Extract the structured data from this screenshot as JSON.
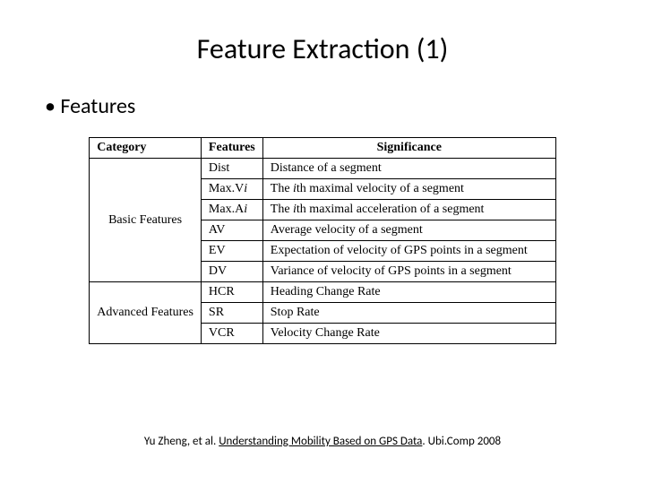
{
  "title": "Feature Extraction (1)",
  "bullet": "Features",
  "headers": {
    "category": "Category",
    "features": "Features",
    "significance": "Significance"
  },
  "categories": {
    "basic": "Basic Features",
    "advanced": "Advanced Features"
  },
  "rows": [
    {
      "feature": "Dist",
      "significance": "Distance of a segment"
    },
    {
      "feature_pre": "Max.V",
      "feature_i": "i",
      "sig_pre": "The ",
      "sig_i": "i",
      "sig_post": "th maximal velocity of a segment"
    },
    {
      "feature_pre": "Max.A",
      "feature_i": "i",
      "sig_pre": "The ",
      "sig_i": "i",
      "sig_post": "th maximal acceleration of a segment"
    },
    {
      "feature": "AV",
      "significance": "Average velocity of a segment"
    },
    {
      "feature": "EV",
      "significance": "Expectation of velocity of GPS points in a segment"
    },
    {
      "feature": "DV",
      "significance": "Variance of velocity of GPS points in a segment"
    },
    {
      "feature": "HCR",
      "significance": "Heading Change Rate"
    },
    {
      "feature": "SR",
      "significance": "Stop Rate"
    },
    {
      "feature": "VCR",
      "significance": "Velocity Change Rate"
    }
  ],
  "citation": {
    "pre": "Yu Zheng, et al. ",
    "link": "Understanding Mobility Based on GPS Data",
    "post": ". Ubi.Comp 2008"
  }
}
